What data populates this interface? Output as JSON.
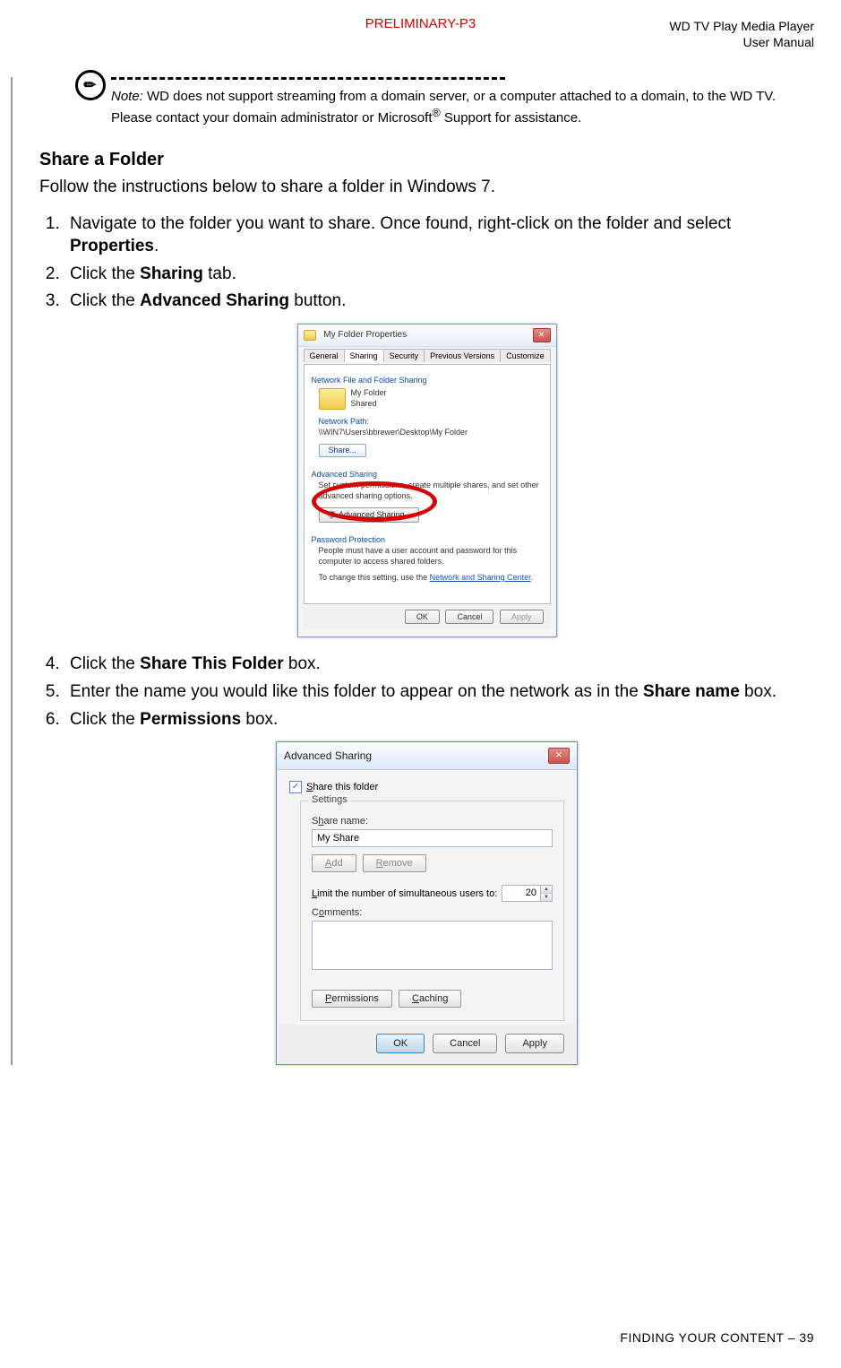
{
  "header": {
    "preliminary": "PRELIMINARY-P3",
    "product_line1": "WD TV Play Media Player",
    "product_line2": "User Manual"
  },
  "note": {
    "label": "Note:",
    "text_part1": " WD does not support streaming from a domain server, or a computer attached to a domain, to the WD TV. Please contact your domain administrator or Microsoft",
    "reg": "®",
    "text_part2": " Support for assistance."
  },
  "section_title": "Share a Folder",
  "intro": "Follow the instructions below to share a folder in Windows 7.",
  "steps": {
    "s1_a": "Navigate to the folder you want to share. Once found, right-click on the folder and select ",
    "s1_b": "Properties",
    "s1_c": ".",
    "s2_a": "Click the ",
    "s2_b": "Sharing",
    "s2_c": " tab.",
    "s3_a": "Click the ",
    "s3_b": "Advanced Sharing",
    "s3_c": " button.",
    "s4_a": "Click the ",
    "s4_b": "Share This Folder",
    "s4_c": " box.",
    "s5_a": "Enter the name you would like this folder to appear on the network as in the ",
    "s5_b": "Share name",
    "s5_c": " box.",
    "s6_a": "Click the ",
    "s6_b": "Permissions",
    "s6_c": " box."
  },
  "dialog1": {
    "title": "My Folder Properties",
    "tabs": {
      "general": "General",
      "sharing": "Sharing",
      "security": "Security",
      "previous": "Previous Versions",
      "customize": "Customize"
    },
    "group_nfs": "Network File and Folder Sharing",
    "folder_name": "My Folder",
    "folder_state": "Shared",
    "netpath_label": "Network Path:",
    "netpath_value": "\\\\WIN7\\Users\\bbrewer\\Desktop\\My Folder",
    "share_btn": "Share...",
    "group_adv": "Advanced Sharing",
    "adv_desc": "Set custom permissions, create multiple shares, and set other advanced sharing options.",
    "adv_btn": "Advanced Sharing...",
    "group_pwd": "Password Protection",
    "pwd_text": "People must have a user account and password for this computer to access shared folders.",
    "pwd_link_pre": "To change this setting, use the ",
    "pwd_link": "Network and Sharing Center",
    "pwd_link_post": ".",
    "ok": "OK",
    "cancel": "Cancel",
    "apply": "Apply"
  },
  "dialog2": {
    "title": "Advanced Sharing",
    "share_checkbox": "hare this folder",
    "share_checkbox_u": "S",
    "settings_label": "Settings",
    "sharename_label_u": "h",
    "sharename_label_pre": "S",
    "sharename_label_post": "are name:",
    "sharename_value": "My Share",
    "add_u": "A",
    "add_post": "dd",
    "remove_u": "R",
    "remove_post": "emove",
    "limit_pre": "",
    "limit_u": "L",
    "limit_post": "imit the number of simultaneous users to:",
    "limit_value": "20",
    "comments_pre": "C",
    "comments_u": "o",
    "comments_post": "mments:",
    "perm_u": "P",
    "perm_post": "ermissions",
    "cache_u": "C",
    "cache_post": "aching",
    "ok": "OK",
    "cancel": "Cancel",
    "apply": "Apply"
  },
  "footer": {
    "section": "FINDING YOUR CONTENT – ",
    "page": "39"
  }
}
